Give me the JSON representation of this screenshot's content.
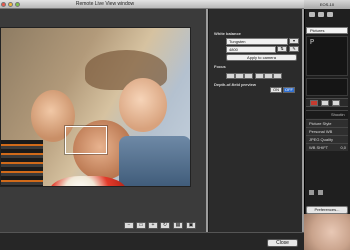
{
  "window": {
    "title": "Remote Live View window"
  },
  "right_panel": {
    "white_balance": {
      "title": "White balance",
      "mode_value": "Tungsten",
      "kelvin_value": "4800",
      "apply_label": "Apply to camera"
    },
    "focus": {
      "title": "Focus"
    },
    "dof_preview": {
      "title": "Depth-of-field preview",
      "on_label": "ON",
      "off_label": "OFF"
    }
  },
  "camera_window": {
    "title": "EOS-10",
    "pictures_label": "Pictures",
    "lcd_value": "P",
    "menu_title": "Shootin",
    "rows": [
      "Picture Style",
      "Personal WB",
      "JPEG Quality",
      "WB SHIFT"
    ],
    "row_values": [
      "",
      "",
      "",
      "0,0"
    ],
    "preferences_label": "Preferences..."
  },
  "bottom": {
    "close_label": "Close"
  }
}
